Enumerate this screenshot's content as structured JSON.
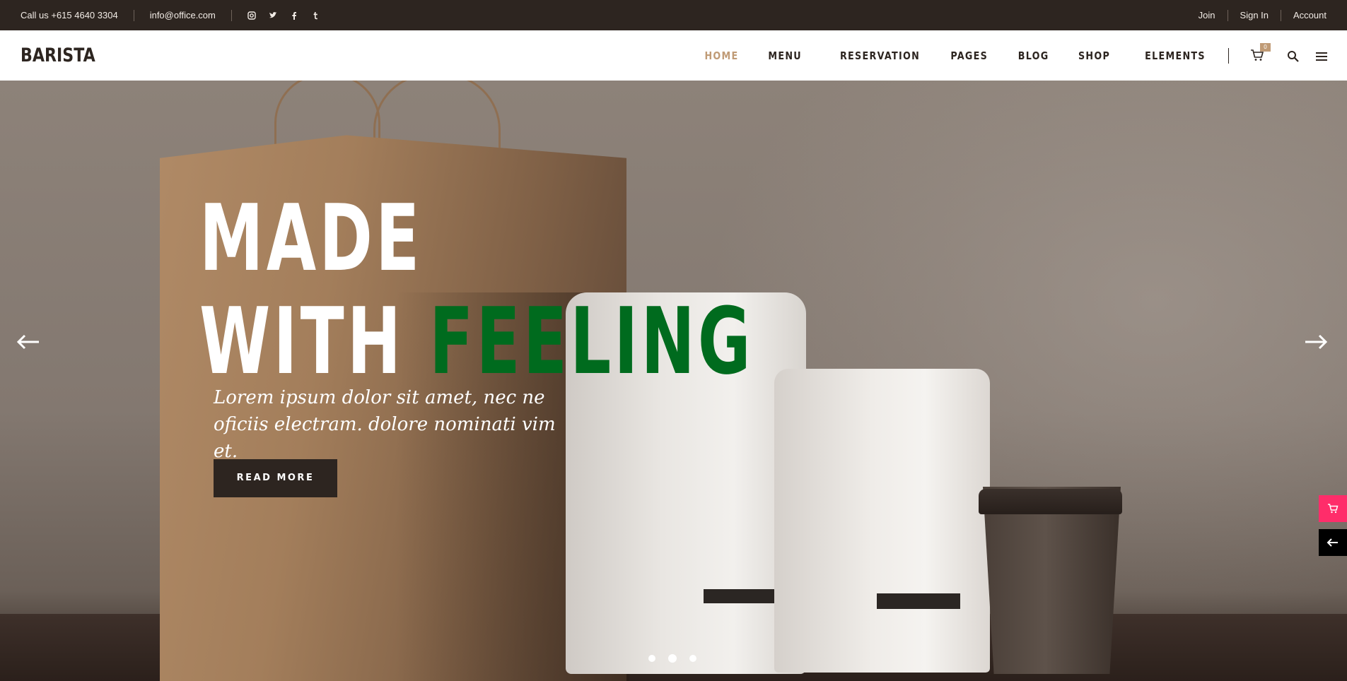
{
  "topbar": {
    "phone": "Call us +615 4640 3304",
    "email": "info@office.com",
    "social": [
      "instagram-icon",
      "twitter-icon",
      "facebook-icon",
      "tumblr-icon"
    ],
    "links": {
      "join": "Join",
      "sign_in": "Sign In",
      "account": "Account"
    }
  },
  "header": {
    "logo": "BARISTA",
    "nav": [
      "HOME",
      "MENU",
      "RESERVATION",
      "PAGES",
      "BLOG",
      "SHOP",
      "ELEMENTS"
    ],
    "active_nav": "HOME",
    "cart_count": "0"
  },
  "hero": {
    "line1": "MADE",
    "line2_white": "WITH",
    "line2_green": "FEELING",
    "subtitle": "Lorem ipsum dolor sit amet, nec ne oficiis electram. dolore nominati vim et.",
    "cta": "READ MORE",
    "slides": 3,
    "active_slide": 2
  },
  "colors": {
    "topbar_bg": "#2d2520",
    "accent": "#c09b76",
    "headline_green": "#006b1e",
    "side_cart": "#ff2d6a"
  }
}
